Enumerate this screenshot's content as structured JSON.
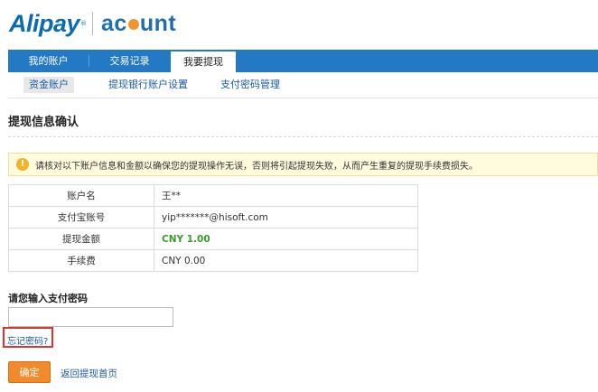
{
  "brand": {
    "alipay": "Alipay",
    "tm": "®",
    "account_pre": "ac",
    "account_post": "unt"
  },
  "nav": {
    "tabs": [
      {
        "label": "我的账户"
      },
      {
        "label": "交易记录"
      },
      {
        "label": "我要提现"
      }
    ],
    "active": "我要提现"
  },
  "subnav": {
    "items": [
      {
        "label": "资金账户"
      },
      {
        "label": "提现银行账户设置"
      },
      {
        "label": "支付密码管理"
      }
    ]
  },
  "page": {
    "title": "提现信息确认"
  },
  "notice": {
    "text": "请核对以下账户信息和金额以确保您的提现操作无误，否则将引起提现失败，从而产生重复的提现手续费损失。",
    "icon": "!"
  },
  "info": {
    "rows": [
      {
        "label": "账户名",
        "value": "王**"
      },
      {
        "label": "支付宝账号",
        "value": "yip*******@hisoft.com"
      },
      {
        "label": "提现金额",
        "value": "CNY 1.00"
      },
      {
        "label": "手续费",
        "value": "CNY 0.00"
      }
    ]
  },
  "password": {
    "label": "请您输入支付密码",
    "value": "",
    "placeholder": "",
    "forgot": "忘记密码?"
  },
  "actions": {
    "confirm": "确定",
    "back": "返回提现首页"
  },
  "colors": {
    "nav": "#2479c4",
    "link": "#1c5aa3",
    "accent": "#f08a2b",
    "amount": "#3c9a2e",
    "highlight": "#d93632"
  }
}
